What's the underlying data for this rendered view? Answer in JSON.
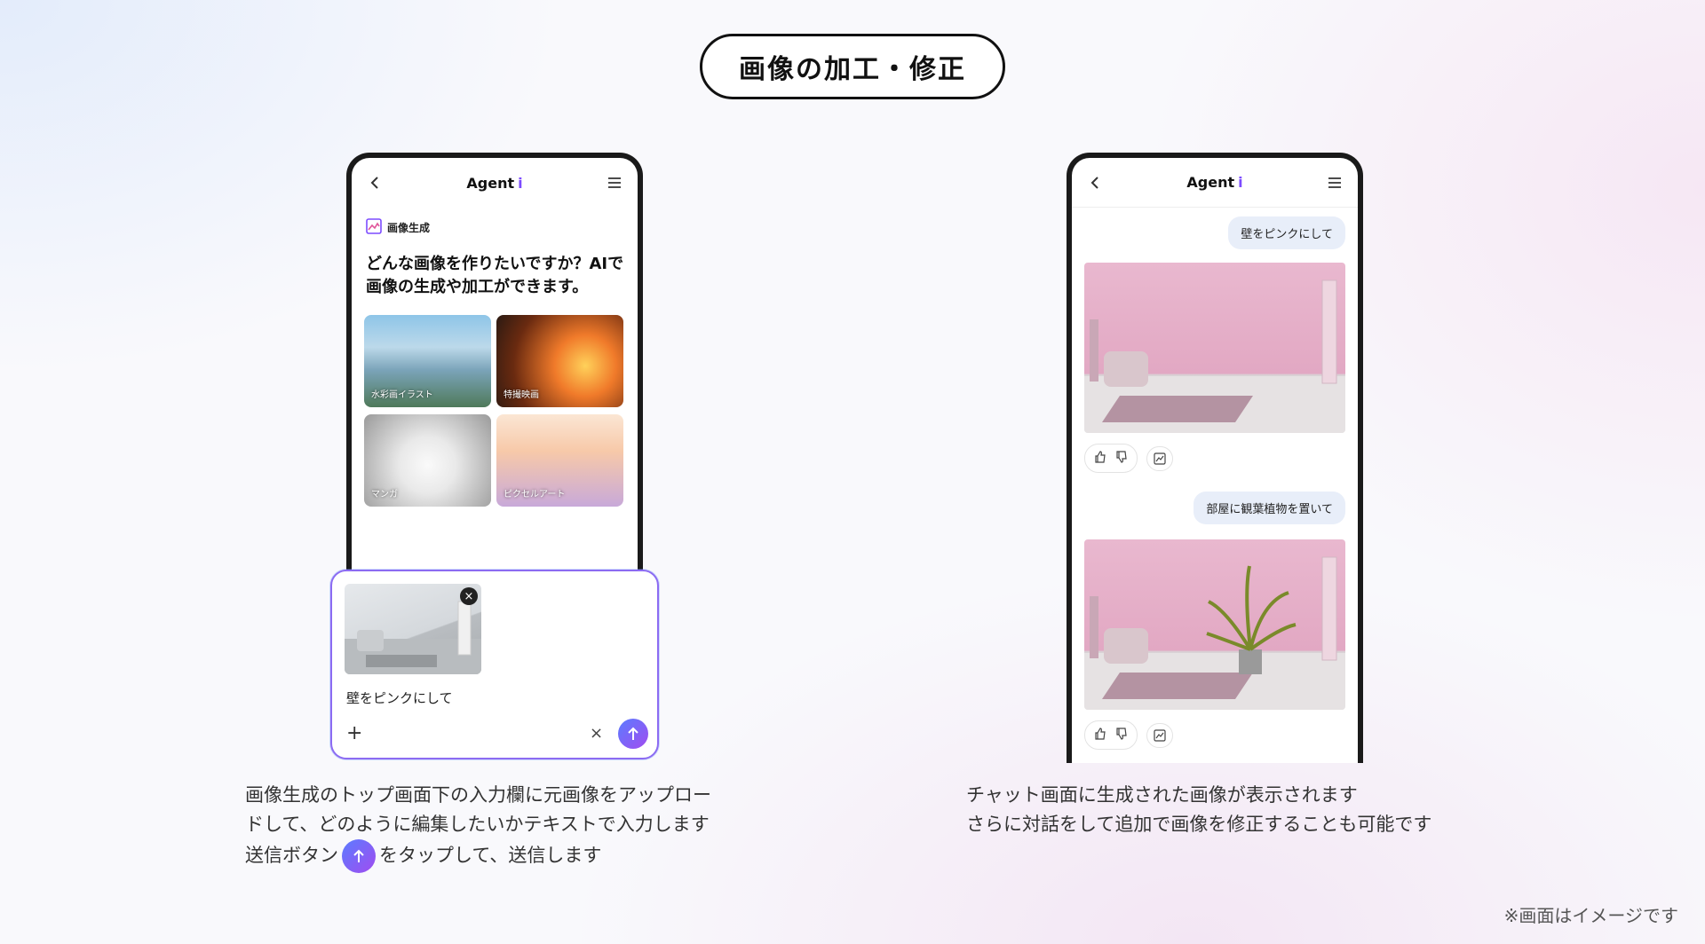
{
  "title": "画像の加工・修正",
  "left_phone": {
    "app_name": "Agent",
    "app_name_accent": "i",
    "section_label": "画像生成",
    "heading": "どんな画像を作りたいですか？AIで画像の生成や加工ができます。",
    "tiles": [
      {
        "label": "水彩画イラスト"
      },
      {
        "label": "特撮映画"
      },
      {
        "label": "マンガ"
      },
      {
        "label": "ピクセルアート"
      }
    ]
  },
  "composer": {
    "text": "壁をピンクにして",
    "plus": "+",
    "clear": "×"
  },
  "right_phone": {
    "app_name": "Agent",
    "app_name_accent": "i",
    "messages": [
      {
        "text": "壁をピンクにして"
      },
      {
        "text": "部屋に観葉植物を置いて"
      }
    ]
  },
  "captions": {
    "left_line1": "画像生成のトップ画面下の入力欄に元画像をアップロー",
    "left_line2": "ドして、どのように編集したいかテキストで入力します",
    "left_line3a": "送信ボタン",
    "left_line3b": "をタップして、送信します",
    "right_line1": "チャット画面に生成された画像が表示されます",
    "right_line2": "さらに対話をして追加で画像を修正することも可能です"
  },
  "note": "※画面はイメージです",
  "colors": {
    "accent": "#7d4cff",
    "send_gradient_start": "#5b7cff",
    "send_gradient_end": "#a14cf0"
  }
}
